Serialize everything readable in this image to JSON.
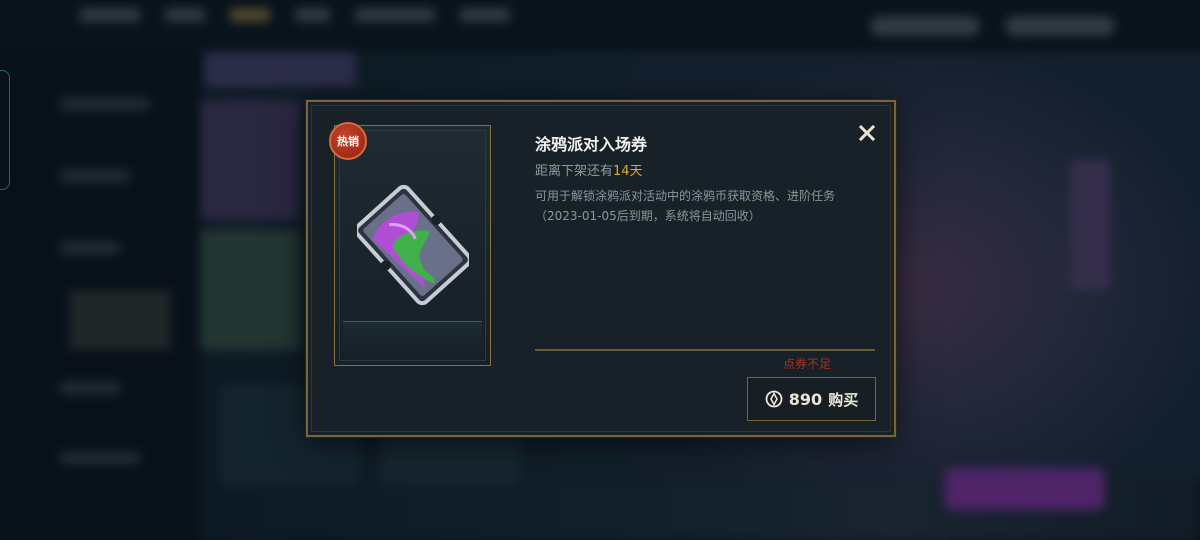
{
  "dialog": {
    "badge": "热销",
    "title": "涂鸦派对入场券",
    "countdown_prefix": "距离下架还有",
    "countdown_days": "14天",
    "description": "可用于解锁涂鸦派对活动中的涂鸦币获取资格、进阶任务（2023-01-05后到期，系统将自动回收）",
    "warning": "点券不足",
    "price": "890",
    "buy_label": "购买",
    "close_icon": "close-icon",
    "currency_icon": "coupon-coin-icon"
  },
  "colors": {
    "gold_border": "#7a6634",
    "highlight_days": "#e0a830",
    "warning": "#a4331f",
    "hot_badge": "#b3361f"
  }
}
